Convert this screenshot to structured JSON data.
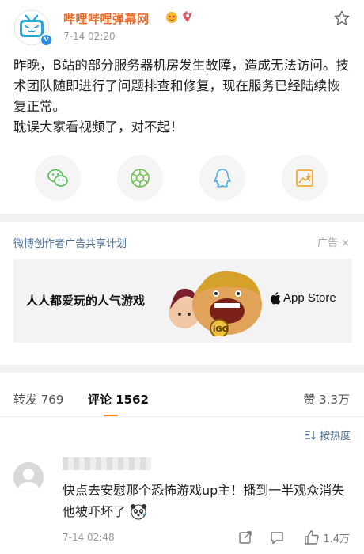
{
  "post": {
    "user_name": "哔哩哔哩弹幕网",
    "time": "7-14 02:20",
    "paragraphs": [
      "昨晚，B站的部分服务器机房发生故障，造成无法访问。技术团队随即进行了问题排查和修复，现在服务已经陆续恢复正常。",
      "耽误大家看视频了，对不起！"
    ],
    "icons": {
      "favorite": "star-outline-icon",
      "share": [
        "wechat-icon",
        "moments-icon",
        "qq-icon",
        "save-image-icon"
      ]
    },
    "colors": {
      "username": "#e8692a",
      "link": "#4a6f95",
      "accent": "#ff8200",
      "verified": "#2e8ee5"
    }
  },
  "ad": {
    "title": "微博创作者广告共享计划",
    "tag": "广告",
    "slogan": "人人都爱玩的人气游戏",
    "store_label": "App Store"
  },
  "tabs": {
    "repost": "转发 769",
    "comment": "评论 1562",
    "like": "赞 3.3万"
  },
  "sort": {
    "label": "按热度"
  },
  "comment": {
    "text": "快点去安慰那个恐怖游戏up主！播到一半观众消失他被吓坏了",
    "time": "7-14 02:48",
    "likes": "1.4万"
  }
}
